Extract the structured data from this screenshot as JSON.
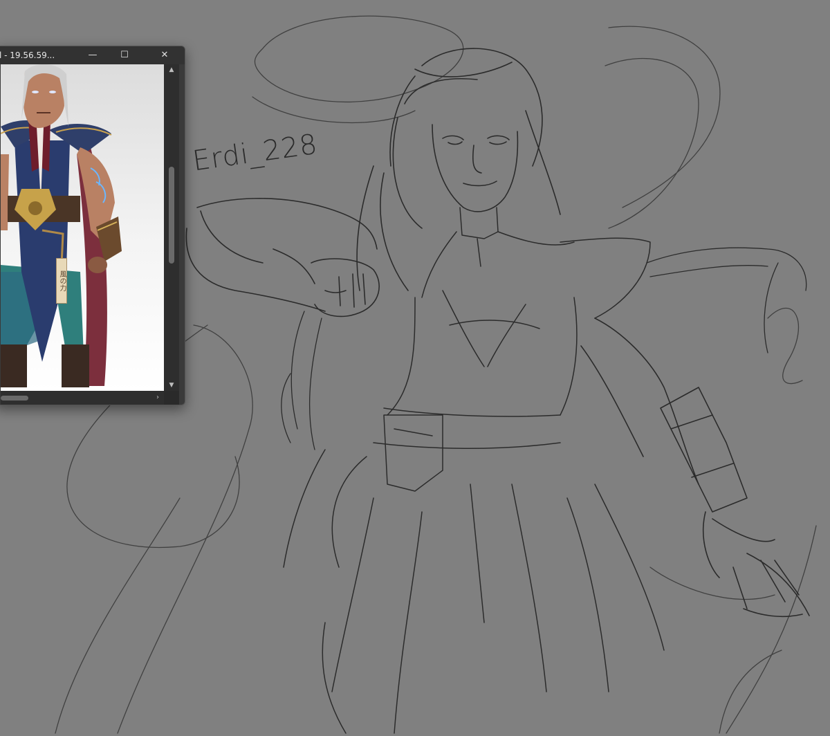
{
  "canvas": {
    "background": "#808080",
    "signature": "Erdi_228",
    "stroke_color": "#2b2b2b"
  },
  "ref_window": {
    "title": "l - 19.56.59...",
    "controls": {
      "minimize_glyph": "—",
      "maximize_glyph": "☐",
      "close_glyph": "✕"
    },
    "scroll": {
      "up_glyph": "▲",
      "down_glyph": "▼",
      "right_glyph": "›"
    },
    "image": {
      "talisman_text": "風の力"
    }
  }
}
